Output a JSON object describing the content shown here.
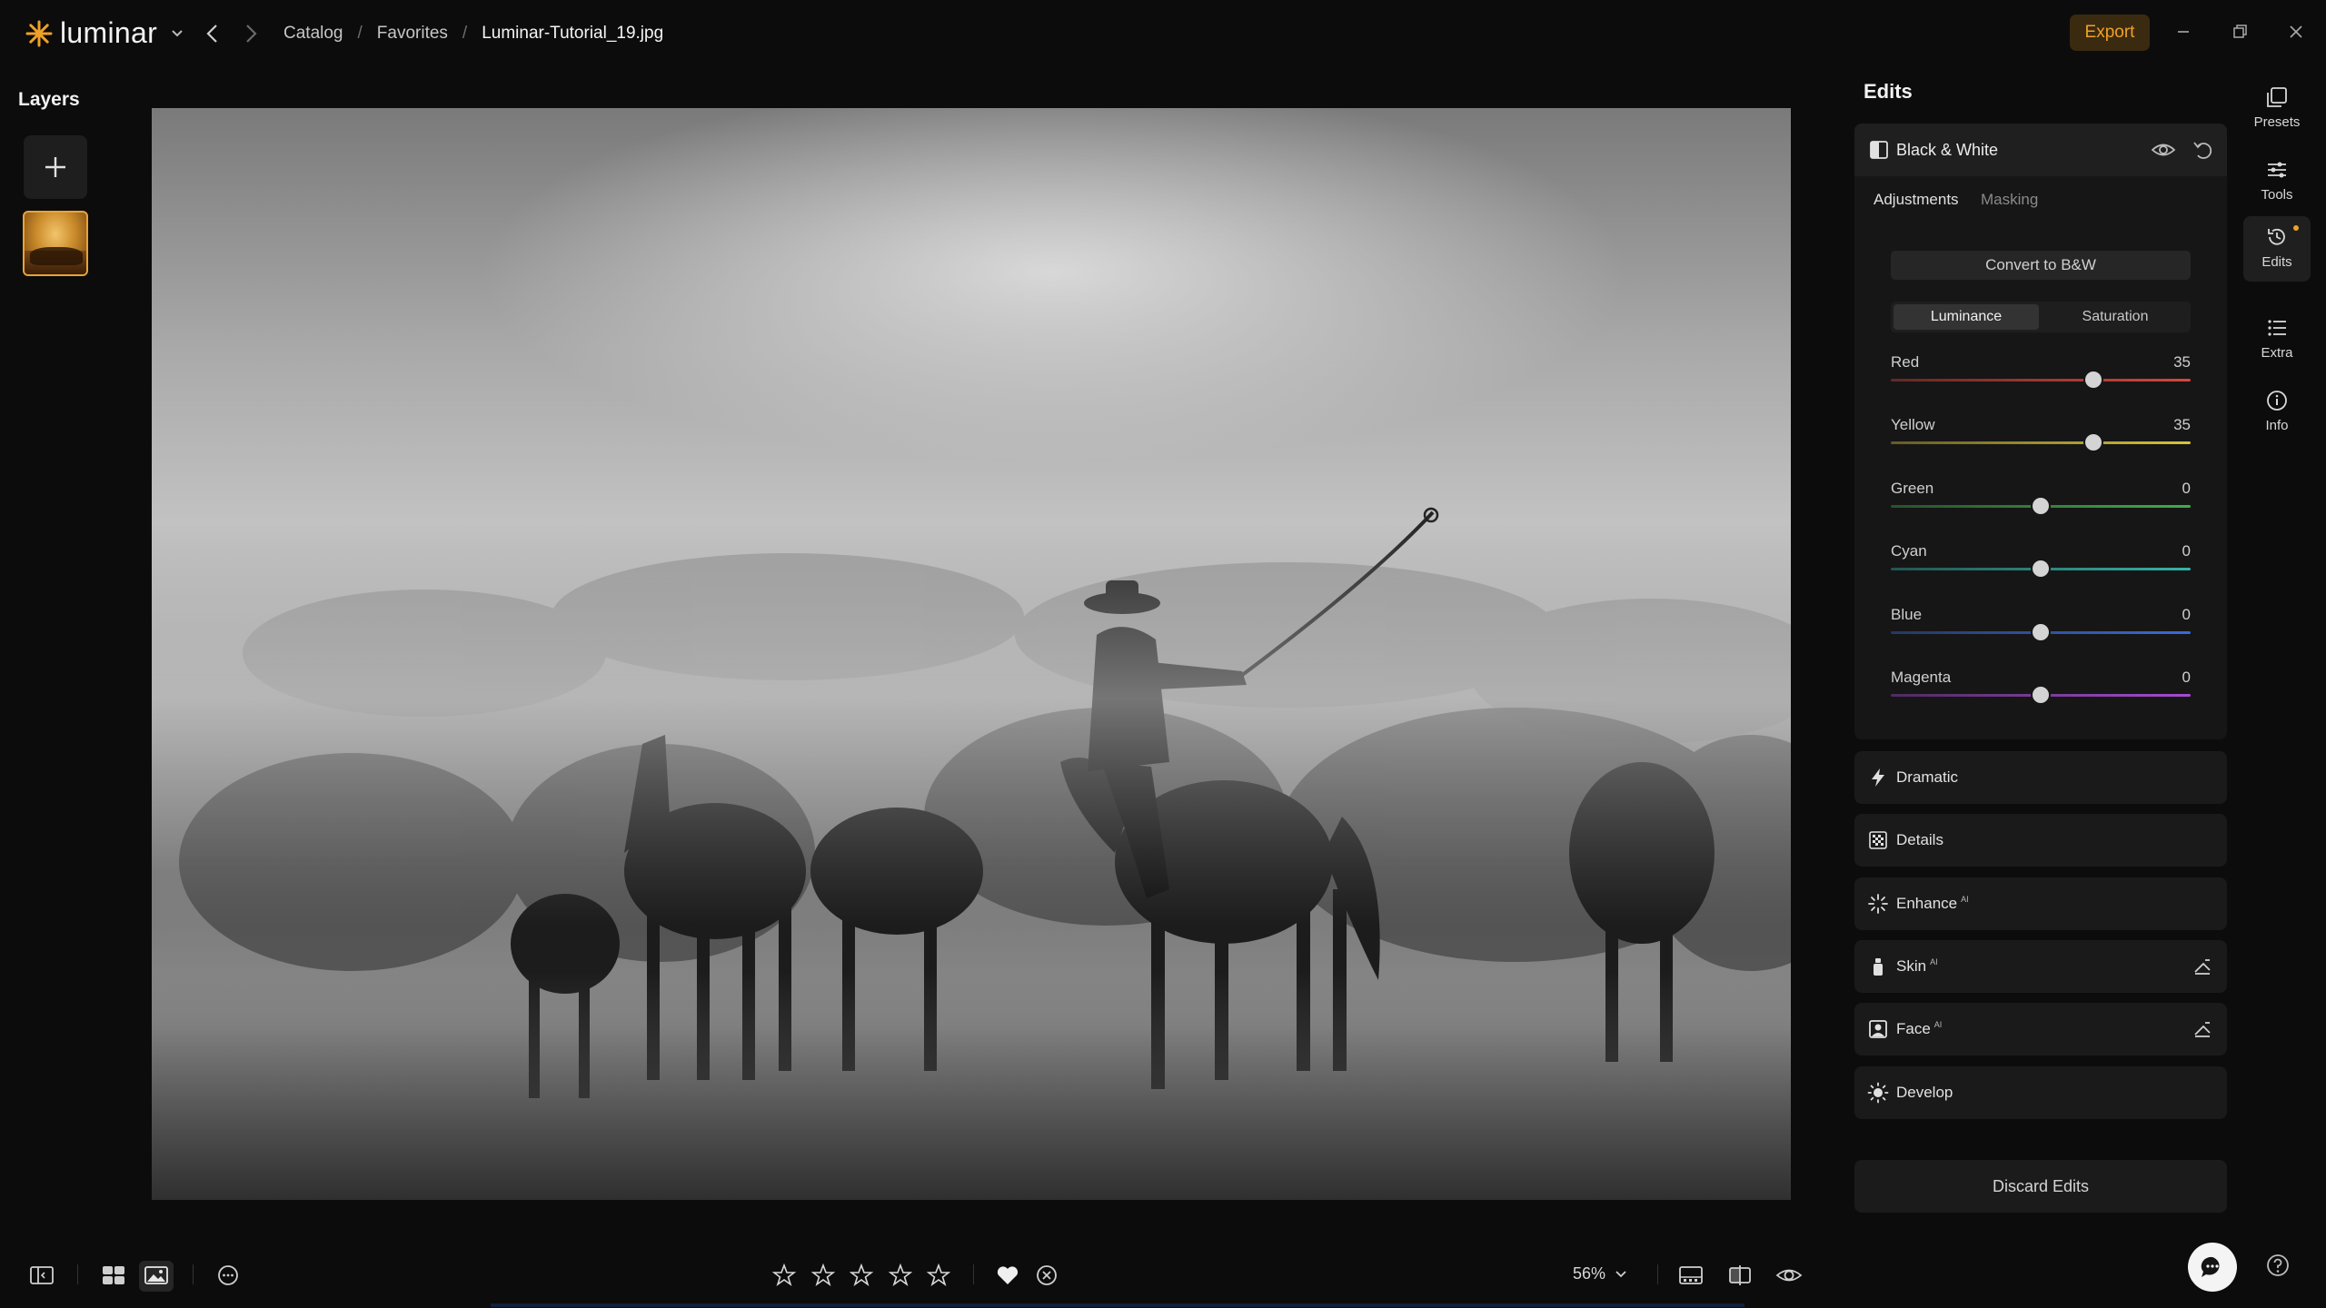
{
  "app": {
    "name": "luminar",
    "accent": "#f0a028"
  },
  "breadcrumb": {
    "items": [
      "Catalog",
      "Favorites"
    ],
    "current": "Luminar-Tutorial_19.jpg",
    "separator": "/"
  },
  "topbar": {
    "export_label": "Export"
  },
  "layers": {
    "title": "Layers"
  },
  "edits": {
    "title": "Edits",
    "tool": {
      "name": "Black & White",
      "tabs": [
        "Adjustments",
        "Masking"
      ],
      "convert_label": "Convert to B&W",
      "modes": [
        "Luminance",
        "Saturation"
      ],
      "channels": [
        {
          "label": "Red",
          "value": 35,
          "color": "#d9453c"
        },
        {
          "label": "Yellow",
          "value": 35,
          "color": "#d8c43a"
        },
        {
          "label": "Green",
          "value": 0,
          "color": "#3fae49"
        },
        {
          "label": "Cyan",
          "value": 0,
          "color": "#35b3a8"
        },
        {
          "label": "Blue",
          "value": 0,
          "color": "#3b6bd6"
        },
        {
          "label": "Magenta",
          "value": 0,
          "color": "#a54bd0"
        }
      ],
      "channel_range": [
        -100,
        100
      ]
    },
    "tools": [
      {
        "label": "Dramatic",
        "ai": ""
      },
      {
        "label": "Details",
        "ai": ""
      },
      {
        "label": "Enhance",
        "ai": "AI"
      },
      {
        "label": "Skin",
        "ai": "AI"
      },
      {
        "label": "Face",
        "ai": "AI"
      },
      {
        "label": "Develop",
        "ai": ""
      }
    ],
    "discard_label": "Discard Edits"
  },
  "rail": [
    "Presets",
    "Tools",
    "Edits",
    "Extra",
    "Info"
  ],
  "bottombar": {
    "zoom": "56%"
  }
}
